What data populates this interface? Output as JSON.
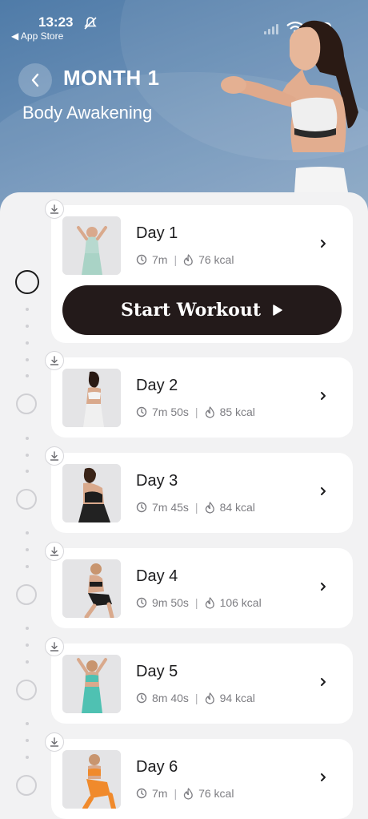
{
  "status_bar": {
    "time": "13:23",
    "back_app": "◀ App Store"
  },
  "header": {
    "title": "MONTH 1",
    "subtitle": "Body Awakening"
  },
  "start_button": {
    "label": "Start Workout"
  },
  "days": [
    {
      "title": "Day 1",
      "duration": "7m",
      "calories": "76 kcal"
    },
    {
      "title": "Day 2",
      "duration": "7m 50s",
      "calories": "85 kcal"
    },
    {
      "title": "Day 3",
      "duration": "7m 45s",
      "calories": "84 kcal"
    },
    {
      "title": "Day 4",
      "duration": "9m 50s",
      "calories": "106 kcal"
    },
    {
      "title": "Day 5",
      "duration": "8m 40s",
      "calories": "94 kcal"
    },
    {
      "title": "Day 6",
      "duration": "7m",
      "calories": "76 kcal"
    }
  ],
  "icons": {
    "back": "chevron-left-icon",
    "download": "download-icon",
    "clock": "clock-icon",
    "flame": "flame-icon",
    "chevron": "chevron-right-icon",
    "play": "play-icon"
  },
  "colors": {
    "header": "#5a84af",
    "button": "#231a1a",
    "background": "#f2f2f3"
  }
}
